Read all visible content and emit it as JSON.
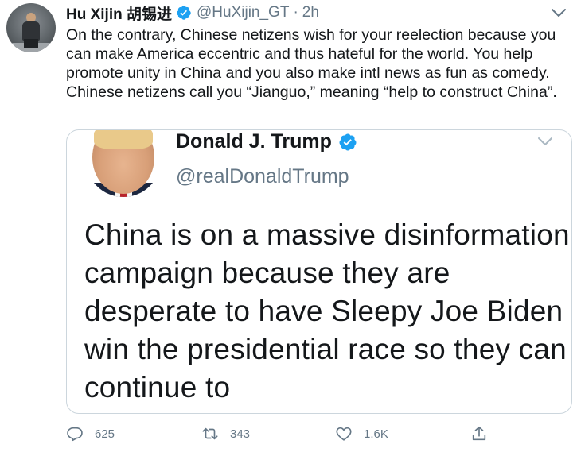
{
  "author": {
    "name": "Hu Xijin 胡锡进",
    "handle": "@HuXijin_GT",
    "separator": "·",
    "time": "2h"
  },
  "tweet": {
    "text": "On the contrary, Chinese netizens wish for your reelection because you can make America eccentric and thus hateful for the world. You help promote unity in China and you also make intl news as fun as comedy. Chinese netizens call you “Jianguo,” meaning “help to construct China”."
  },
  "quoted": {
    "name": "Donald J. Trump",
    "handle": "@realDonaldTrump",
    "text": "China is on a massive disinformation campaign because they are desperate to have Sleepy Joe Biden win the presidential race so they can continue to"
  },
  "actions": {
    "reply_count": "625",
    "retweet_count": "343",
    "like_count": "1.6K"
  },
  "icons": {
    "verified": "verified-badge-icon",
    "menu": "chevron-down-icon",
    "reply": "reply-icon",
    "retweet": "retweet-icon",
    "like": "heart-icon",
    "share": "share-icon"
  },
  "colors": {
    "accent": "#1da1f2",
    "muted": "#657786",
    "text": "#14171a",
    "border": "#ccd6dd"
  }
}
